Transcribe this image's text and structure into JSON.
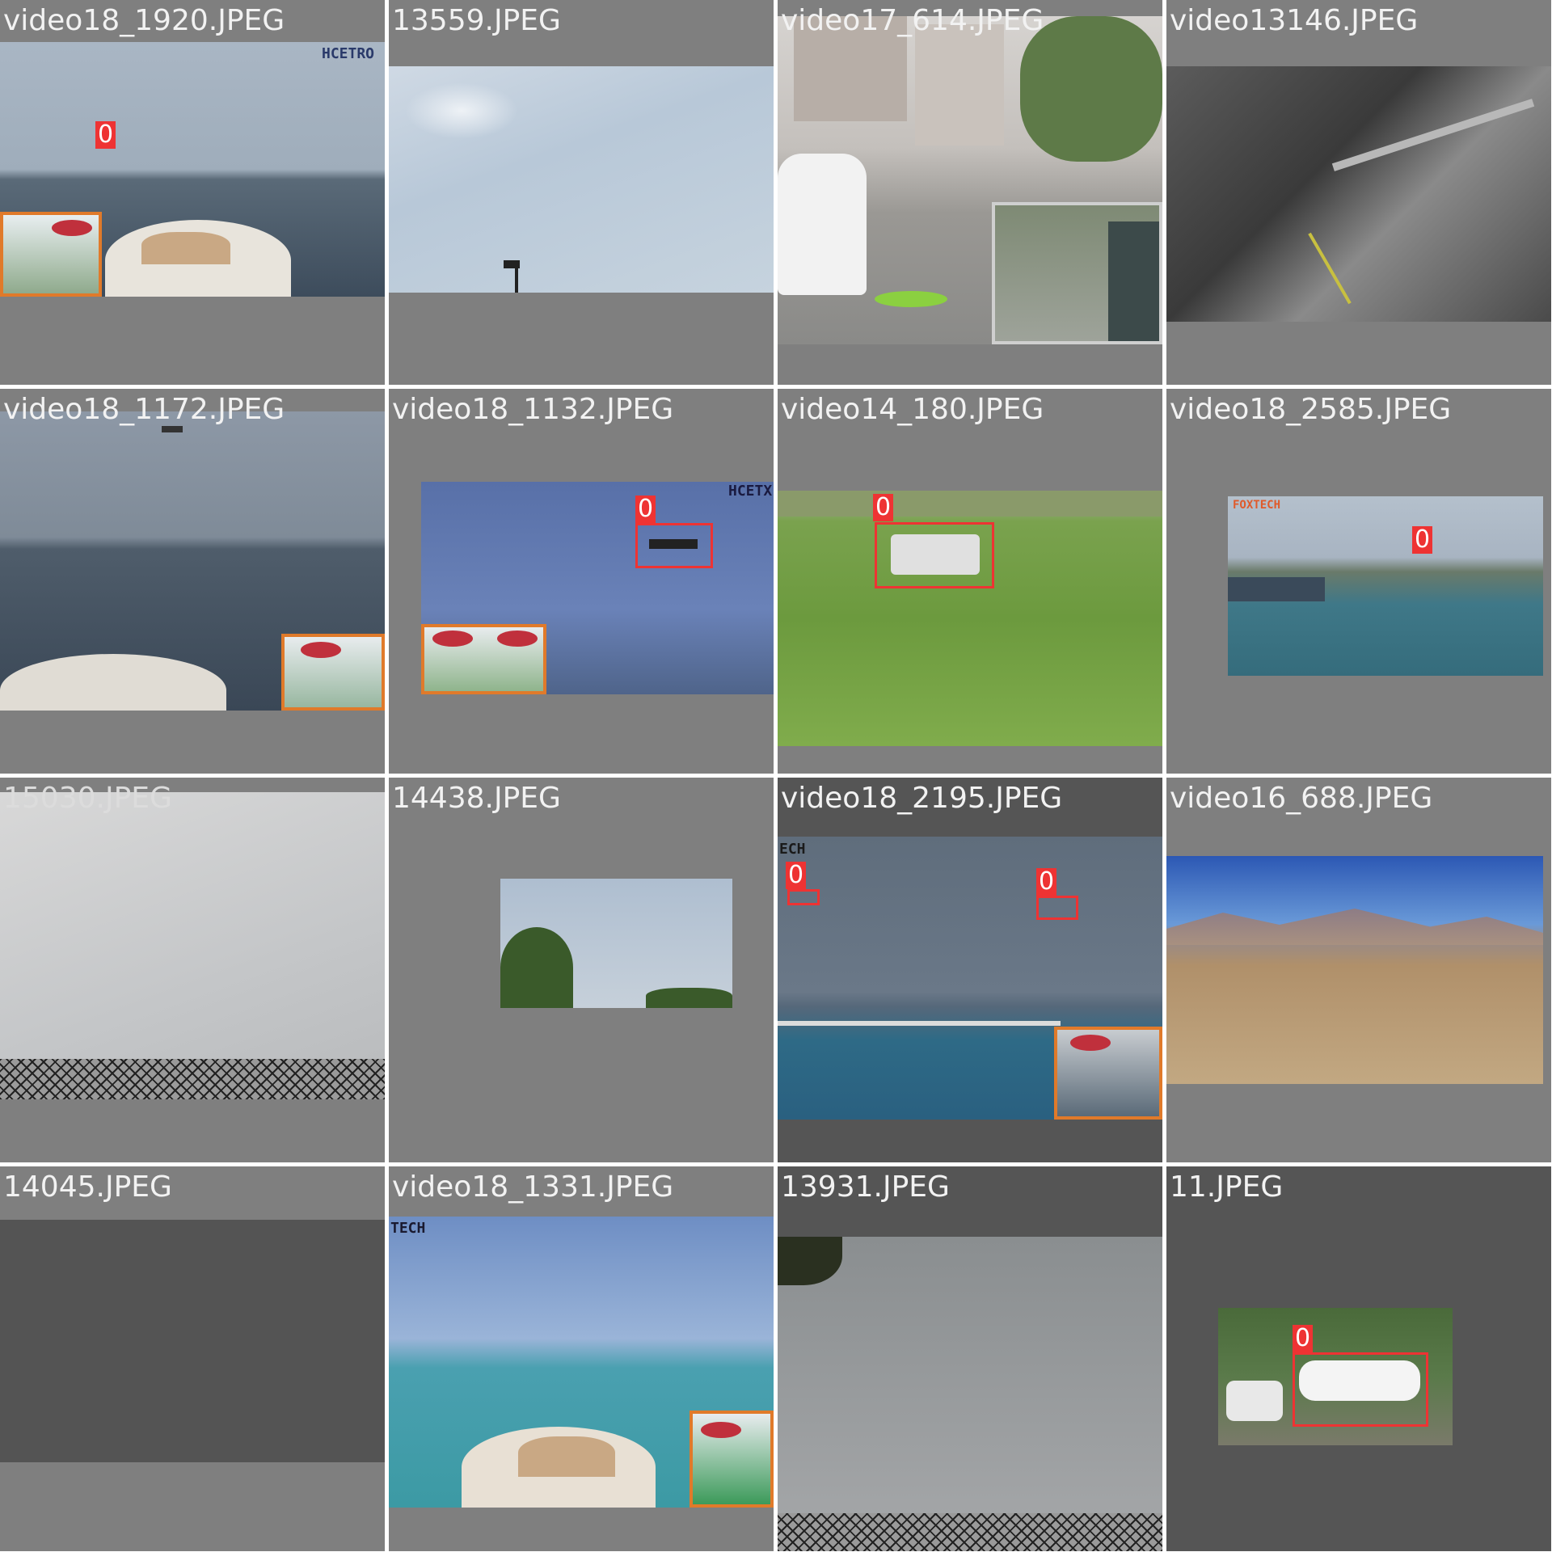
{
  "colors": {
    "tile_background": "#7f7f7f",
    "dark_tile_background": "#555555",
    "detection": "#ee3333",
    "label_text": "#f2f2f2"
  },
  "tiles": [
    {
      "filename": "video18_1920.JPEG",
      "detections": [
        "0"
      ],
      "watermark": "HCETRO"
    },
    {
      "filename": "13559.JPEG",
      "detections": []
    },
    {
      "filename": "video17_614.JPEG",
      "detections": []
    },
    {
      "filename": "video13146.JPEG",
      "detections": []
    },
    {
      "filename": "video18_1172.JPEG",
      "detections": []
    },
    {
      "filename": "video18_1132.JPEG",
      "detections": [
        "0"
      ],
      "watermark": "HCETX"
    },
    {
      "filename": "video14_180.JPEG",
      "detections": [
        "0"
      ]
    },
    {
      "filename": "video18_2585.JPEG",
      "detections": [
        "0"
      ],
      "watermark": "FOXTECH"
    },
    {
      "filename": "15030.JPEG",
      "detections": []
    },
    {
      "filename": "14438.JPEG",
      "detections": []
    },
    {
      "filename": "video18_2195.JPEG",
      "detections": [
        "0",
        "0"
      ],
      "watermark": "ECH"
    },
    {
      "filename": "video16_688.JPEG",
      "detections": []
    },
    {
      "filename": "14045.JPEG",
      "detections": []
    },
    {
      "filename": "video18_1331.JPEG",
      "detections": [],
      "watermark": "TECH"
    },
    {
      "filename": "13931.JPEG",
      "detections": []
    },
    {
      "filename": "11.JPEG",
      "detections": [
        "0"
      ]
    }
  ]
}
